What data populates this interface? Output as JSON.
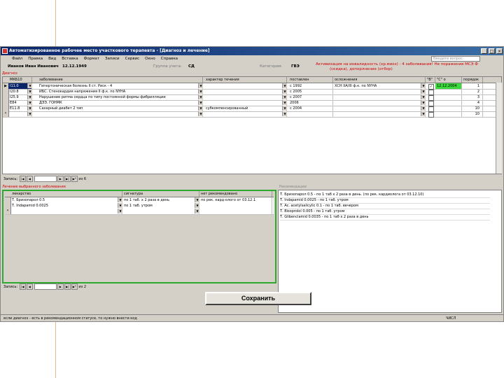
{
  "window": {
    "title": "Автоматизированное рабочее место участкового терапевта - [Диагноз и лечение]",
    "minimize": "_",
    "maximize": "□",
    "close": "×"
  },
  "menu": [
    "Файл",
    "Правка",
    "Вид",
    "Вставка",
    "Формат",
    "Записи",
    "Сервис",
    "Окно",
    "Справка"
  ],
  "help_placeholder": "Введите вопрос",
  "patient": {
    "name": "Иванов Иван Иванович",
    "dob": "12.12.1949",
    "group_label": "Группа учета:",
    "group": "СД",
    "category_label": "Категория:",
    "category": "ГВЭ",
    "warning": "Активизация на инвалидность (хр.миоз) - 4 заболевания! Не поражения МСЭ Ф",
    "warning2": "(скидка), допорлнение (отбор)"
  },
  "diagnoses": {
    "section_label": "Диагноз",
    "columns": [
      "МКБ10",
      "заболевание",
      "характер течения",
      "поставлен",
      "осложнения",
      "\"В\"",
      "\"С\" о",
      "порядок"
    ],
    "rows": [
      {
        "code": "I11.0",
        "disease": "Гипертоническая болезнь II ст. Риск - 4",
        "course": "",
        "date": "с 1992",
        "complication": "ХСН IIA/III ф.к. по NYHA",
        "b": true,
        "c": "12.12.2004",
        "order": "1",
        "current": true
      },
      {
        "code": "I20.8",
        "disease": "ИБС. Стенокардия напряжения II ф.к. по NYHA",
        "course": "",
        "date": "с 2005",
        "complication": "",
        "b": false,
        "c": "",
        "order": "2",
        "current": false
      },
      {
        "code": "I25.9",
        "disease": "Нарушение ритма сердца по типу постоянной формы фибрилляции",
        "course": "",
        "date": "с 2007",
        "complication": "",
        "b": false,
        "c": "",
        "order": "3",
        "current": false
      },
      {
        "code": "E84",
        "disease": "ДЭЭ. ГОНМК",
        "course": "",
        "date": "2006",
        "complication": "",
        "b": false,
        "c": "",
        "order": "4",
        "current": false
      },
      {
        "code": "E11.8",
        "disease": "Сахарный диабет 2 тип",
        "course": "субкомпенсированный",
        "date": "с 2004",
        "complication": "",
        "b": false,
        "c": "",
        "order": "10",
        "current": false
      },
      {
        "code": "",
        "disease": "",
        "course": "",
        "date": "",
        "complication": "",
        "b": false,
        "c": "",
        "order": "10",
        "current": false,
        "new": true
      }
    ],
    "nav": {
      "label": "Запись:",
      "of": "из 6"
    }
  },
  "prescriptions": {
    "section_label": "Лечение выбранного заболевания",
    "columns": [
      "лекарство",
      "сигнатура",
      "нет рекомендовано"
    ],
    "rows": [
      {
        "drug": "Т. Бризопарол 0.5",
        "signature": "по 1 таб. x 2 раза в день",
        "note": "по рек. кард-олого от 03.12.1"
      },
      {
        "drug": "Т. Indapamid 0.0025",
        "signature": "по 1 таб. утром",
        "note": ""
      },
      {
        "drug": "",
        "signature": "",
        "note": "",
        "new": true
      }
    ],
    "nav": {
      "label": "Запись:",
      "of": "из 2"
    }
  },
  "history": {
    "section_label": "Рекомендации",
    "lines": [
      "Т. Бризопарол 0.5 - по 1 таб x 2 раза в день. (по рек. кардиолога от 03.12.10)",
      "Т. Indapamid 0.0025 - по 1 таб. утром",
      "Т. Ac. acetylsalicylic 0.1 - по 1 таб. вечером",
      "Т. Bisoprolol 0.005 - по 1 таб. утром",
      "Т. Glibenclamid 0.0035 - по 1 таб x 2 раза в день"
    ]
  },
  "save_button": "Сохранить",
  "status_left": "если диагноз - есть в рекомендационном статусе, то нужно внести код",
  "status_right": "ЧИСЛ"
}
